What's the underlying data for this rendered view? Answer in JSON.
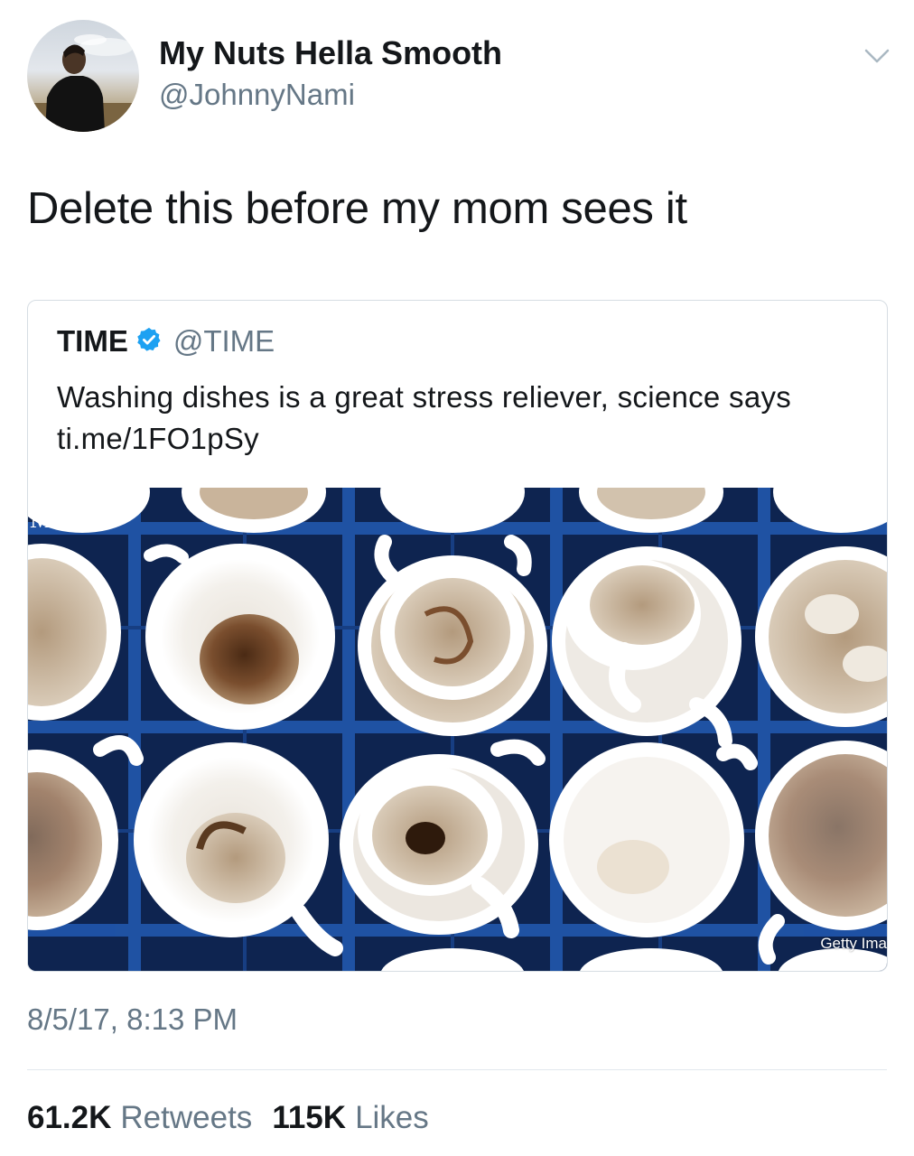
{
  "tweet": {
    "display_name": "My Nuts Hella Smooth",
    "handle": "@JohnnyNami",
    "text": "Delete this before my mom sees it",
    "timestamp": "8/5/17, 8:13 PM",
    "retweets_count": "61.2K",
    "retweets_label": "Retweets",
    "likes_count": "115K",
    "likes_label": "Likes"
  },
  "quoted_tweet": {
    "name": "TIME",
    "handle": "@TIME",
    "verified": true,
    "text": "Washing dishes is a great stress reliever, science says ti.me/1FO1pSy",
    "media": {
      "watermark": "ME",
      "credit": "Getty Ima"
    }
  },
  "icons": {
    "caret": "chevron-down-icon",
    "verified": "verified-badge-icon"
  },
  "colors": {
    "text_primary": "#14171a",
    "text_secondary": "#657786",
    "verified_blue": "#1da1f2",
    "divider": "#e1e8ed",
    "rack_blue": "#1a4d9c"
  }
}
